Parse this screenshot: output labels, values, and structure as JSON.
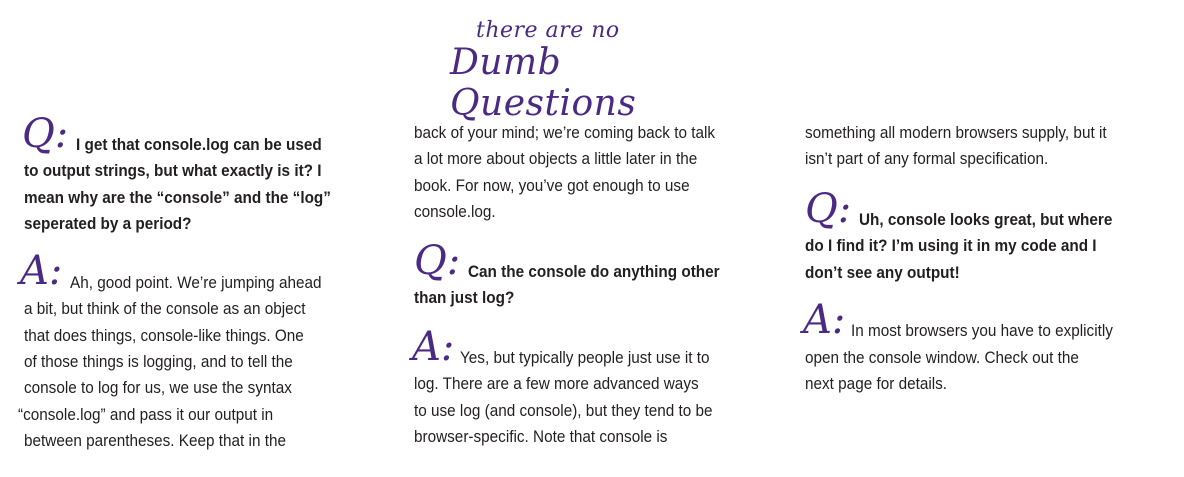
{
  "header": {
    "line1": "there are no",
    "line2": "Dumb Questions"
  },
  "marks": {
    "q": "Q:",
    "a": "A:"
  },
  "col1": {
    "q1": [
      "I get that console.log can be used",
      "to output strings, but what exactly is it? I",
      "mean why are the “console” and the “log”",
      "seperated by a period?"
    ],
    "a1": [
      "Ah, good point. We’re jumping ahead",
      "a bit, but think of the console as an object",
      "that does things, console-like things. One",
      "of those things is logging, and to tell the",
      "console to log for us, we use the syntax",
      "“console.log” and pass it our output in",
      "between parentheses. Keep that in the"
    ]
  },
  "col2": {
    "a1_cont": [
      "back of your mind; we’re coming back to talk",
      "a lot more about objects a little later in the",
      "book. For now, you’ve got enough to use",
      "console.log."
    ],
    "q2": [
      "Can the console do anything other",
      "than just log?"
    ],
    "a2": [
      "Yes, but typically people just use it to",
      "log. There are a few more advanced ways",
      "to use log (and console), but they tend to be",
      "browser-specific. Note that console is"
    ]
  },
  "col3": {
    "a2_cont": [
      "something all modern browsers supply, but it",
      "isn’t part of any formal specification."
    ],
    "q3": [
      "Uh, console looks great, but where",
      "do I find it? I’m using it in my code and I",
      "don’t see any output!"
    ],
    "a3": [
      "In most browsers you have to explicitly",
      "open the console window. Check out the",
      "next page for details."
    ]
  }
}
